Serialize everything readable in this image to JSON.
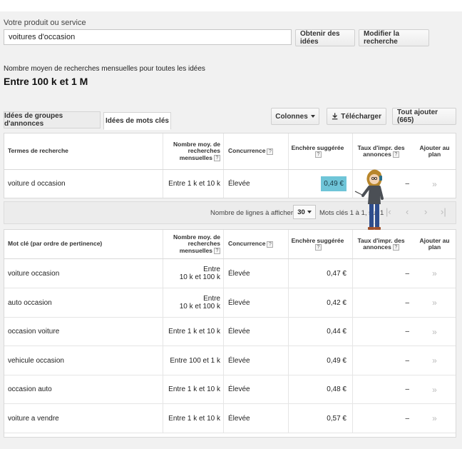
{
  "search": {
    "label": "Votre produit ou service",
    "value": "voitures d'occasion",
    "get_ideas_label": "Obtenir des idées",
    "modify_label": "Modifier la recherche"
  },
  "summary": {
    "label": "Nombre moyen de recherches mensuelles pour toutes les idées",
    "value": "Entre 100 k et 1 M"
  },
  "tabs": {
    "ad_groups": "Idées de groupes d'annonces",
    "keywords": "Idées de mots clés"
  },
  "toolbar": {
    "columns_label": "Colonnes",
    "download_label": "Télécharger",
    "add_all_label": "Tout ajouter (665)"
  },
  "table1": {
    "headers": {
      "term": "Termes de recherche",
      "volume_l1": "Nombre moy. de",
      "volume_l2": "recherches",
      "volume_l3": "mensuelles",
      "competition": "Concurrence",
      "bid": "Enchère suggérée",
      "impr_l1": "Taux d'impr. des",
      "impr_l2": "annonces",
      "add_l1": "Ajouter au",
      "add_l2": "plan",
      "help": "?"
    },
    "rows": [
      {
        "term": "voiture d occasion",
        "volume": "Entre 1 k et 10 k",
        "competition": "Élevée",
        "bid": "0,49 €",
        "impr": "–",
        "add": "»"
      }
    ]
  },
  "pager": {
    "rows_label": "Nombre de lignes à afficher :",
    "rows_value": "30",
    "info": "Mots clés 1 à 1, sur 1",
    "first": "|‹",
    "prev": "‹",
    "next": "›",
    "last": "›|"
  },
  "table2": {
    "headers": {
      "term": "Mot clé (par ordre de pertinence)",
      "volume_l1": "Nombre moy. de",
      "volume_l2": "recherches",
      "volume_l3": "mensuelles",
      "competition": "Concurrence",
      "bid": "Enchère suggérée",
      "impr_l1": "Taux d'impr. des",
      "impr_l2": "annonces",
      "add_l1": "Ajouter au",
      "add_l2": "plan",
      "help": "?"
    },
    "rows": [
      {
        "term": "voiture occasion",
        "volume_l1": "Entre",
        "volume_l2": "10 k et 100 k",
        "competition": "Élevée",
        "bid": "0,47 €",
        "impr": "–",
        "add": "»"
      },
      {
        "term": "auto occasion",
        "volume_l1": "Entre",
        "volume_l2": "10 k et 100 k",
        "competition": "Élevée",
        "bid": "0,42 €",
        "impr": "–",
        "add": "»"
      },
      {
        "term": "occasion voiture",
        "volume_l1": "Entre 1 k et 10 k",
        "volume_l2": "",
        "competition": "Élevée",
        "bid": "0,44 €",
        "impr": "–",
        "add": "»"
      },
      {
        "term": "vehicule occasion",
        "volume_l1": "Entre 100 et 1 k",
        "volume_l2": "",
        "competition": "Élevée",
        "bid": "0,49 €",
        "impr": "–",
        "add": "»"
      },
      {
        "term": "occasion auto",
        "volume_l1": "Entre 1 k et 10 k",
        "volume_l2": "",
        "competition": "Élevée",
        "bid": "0,48 €",
        "impr": "–",
        "add": "»"
      },
      {
        "term": "voiture a vendre",
        "volume_l1": "Entre 1 k et 10 k",
        "volume_l2": "",
        "competition": "Élevée",
        "bid": "0,57 €",
        "impr": "–",
        "add": "»"
      }
    ]
  },
  "colors": {
    "highlight": "#6fc5d8",
    "panel_bg": "#f1f1f1"
  }
}
